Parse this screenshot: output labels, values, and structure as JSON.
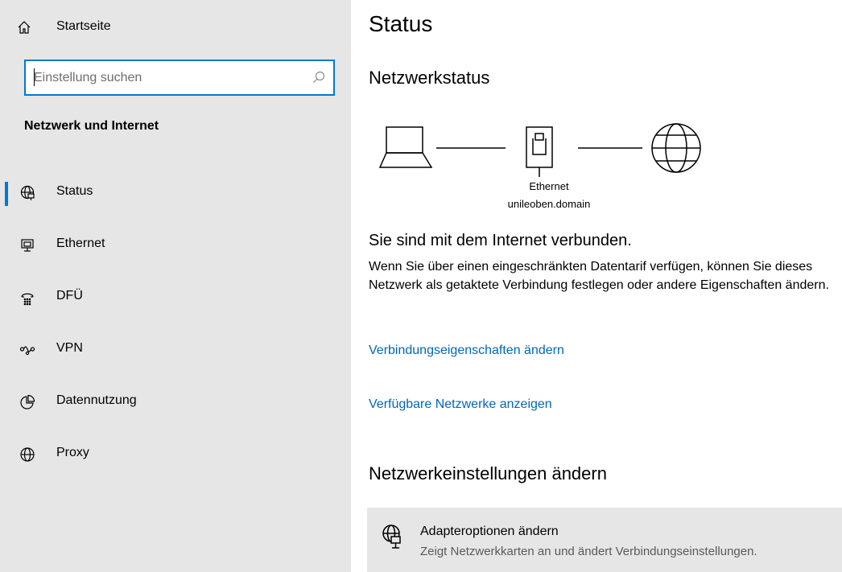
{
  "sidebar": {
    "home_label": "Startseite",
    "search_placeholder": "Einstellung suchen",
    "section_title": "Netzwerk und Internet",
    "items": [
      {
        "label": "Status",
        "icon": "globe-network-icon",
        "selected": true
      },
      {
        "label": "Ethernet",
        "icon": "ethernet-icon",
        "selected": false
      },
      {
        "label": "DFÜ",
        "icon": "dialup-icon",
        "selected": false
      },
      {
        "label": "VPN",
        "icon": "vpn-icon",
        "selected": false
      },
      {
        "label": "Datennutzung",
        "icon": "data-usage-icon",
        "selected": false
      },
      {
        "label": "Proxy",
        "icon": "globe-icon",
        "selected": false
      }
    ]
  },
  "main": {
    "title": "Status",
    "network_status_heading": "Netzwerkstatus",
    "diagram": {
      "adapter_label": "Ethernet",
      "domain_label": "unileoben.domain"
    },
    "connected_text": "Sie sind mit dem Internet verbunden.",
    "description": "Wenn Sie über einen eingeschränkten Datentarif verfügen, können Sie dieses Netzwerk als getaktete Verbindung festlegen oder andere Eigenschaften ändern.",
    "link_connection_properties": "Verbindungseigenschaften ändern",
    "link_available_networks": "Verfügbare Netzwerke anzeigen",
    "change_settings_heading": "Netzwerkeinstellungen ändern",
    "adapter_option": {
      "title": "Adapteroptionen ändern",
      "subtitle": "Zeigt Netzwerkkarten an und ändert Verbindungseinstellungen."
    }
  },
  "colors": {
    "accent": "#0078d7",
    "link": "#0067b8",
    "sidebar_bg": "#e6e6e6"
  }
}
